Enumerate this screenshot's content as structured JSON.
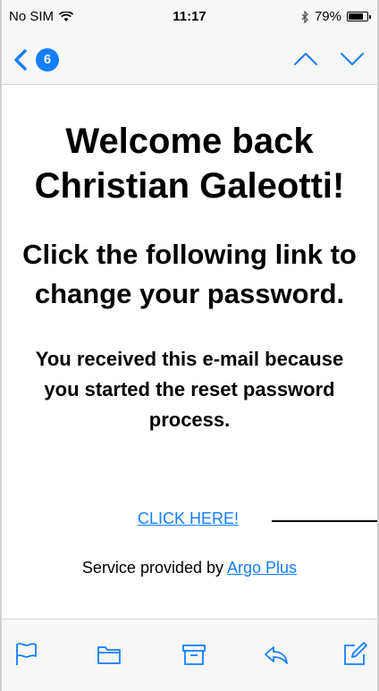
{
  "status_bar": {
    "carrier": "No SIM",
    "time": "11:17",
    "battery_pct": "79%",
    "battery_level": 0.79
  },
  "nav": {
    "unread_count": "6"
  },
  "email": {
    "title": "Welcome back Christian Galeotti!",
    "subtitle": "Click the following link to change your password.",
    "body": "You received this e-mail because you started the reset password process.",
    "link_text": "CLICK HERE!",
    "service_prefix": "Service provided by ",
    "service_link": "Argo Plus"
  },
  "icons": {
    "back": "chevron-left-icon",
    "prev": "chevron-up-icon",
    "next": "chevron-down-icon",
    "flag": "flag-icon",
    "folder": "folder-icon",
    "archive": "archive-icon",
    "reply": "reply-icon",
    "compose": "compose-icon"
  },
  "colors": {
    "accent": "#147efb",
    "bar_background": "#f7f7f7"
  }
}
